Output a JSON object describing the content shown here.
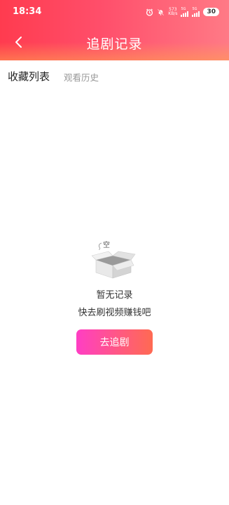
{
  "status_bar": {
    "time": "18:34",
    "net_speed_value": "573",
    "net_speed_unit": "KB/s",
    "signal1_label": "5G",
    "signal2_label": "5G",
    "battery": "30",
    "icons": [
      "alarm-icon",
      "mute-icon",
      "signal-icon",
      "battery-icon"
    ]
  },
  "header": {
    "title": "追剧记录",
    "back_icon": "chevron-left-icon"
  },
  "tabs": [
    {
      "label": "收藏列表",
      "active": true
    },
    {
      "label": "观看历史",
      "active": false
    }
  ],
  "empty_state": {
    "illustration_text": "空",
    "title": "暂无记录",
    "subtitle": "快去刷视频赚钱吧",
    "button_label": "去追剧"
  },
  "colors": {
    "header_start": "#ff3b4f",
    "header_end": "#ff7a86",
    "button_start": "#ff3ec4",
    "button_end": "#ff6a52"
  }
}
